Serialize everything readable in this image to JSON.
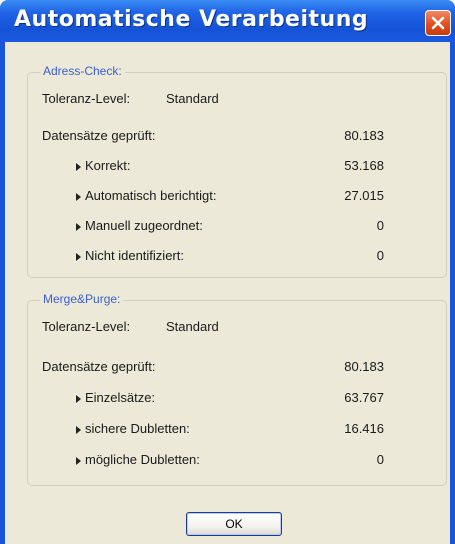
{
  "window": {
    "title": "Automatische Verarbeitung"
  },
  "adress_check": {
    "legend": "Adress-Check:",
    "tolerance_label": "Toleranz-Level:",
    "tolerance_value": "Standard",
    "checked_label": "Datensätze geprüft:",
    "checked_value": "80.183",
    "items": [
      {
        "label": "Korrekt:",
        "value": "53.168"
      },
      {
        "label": "Automatisch berichtigt:",
        "value": "27.015"
      },
      {
        "label": "Manuell zugeordnet:",
        "value": "0"
      },
      {
        "label": "Nicht identifiziert:",
        "value": "0"
      }
    ]
  },
  "merge_purge": {
    "legend": "Merge&Purge:",
    "tolerance_label": "Toleranz-Level:",
    "tolerance_value": "Standard",
    "checked_label": "Datensätze geprüft:",
    "checked_value": "80.183",
    "items": [
      {
        "label": "Einzelsätze:",
        "value": "63.767"
      },
      {
        "label": "sichere Dubletten:",
        "value": "16.416"
      },
      {
        "label": "mögliche Dubletten:",
        "value": "0"
      }
    ]
  },
  "buttons": {
    "ok_label": "OK"
  },
  "colors": {
    "titlebar": "#1f63e6",
    "close_button": "#e0501f",
    "dialog_background": "#ece9d8",
    "legend_text": "#3b5fcf"
  }
}
